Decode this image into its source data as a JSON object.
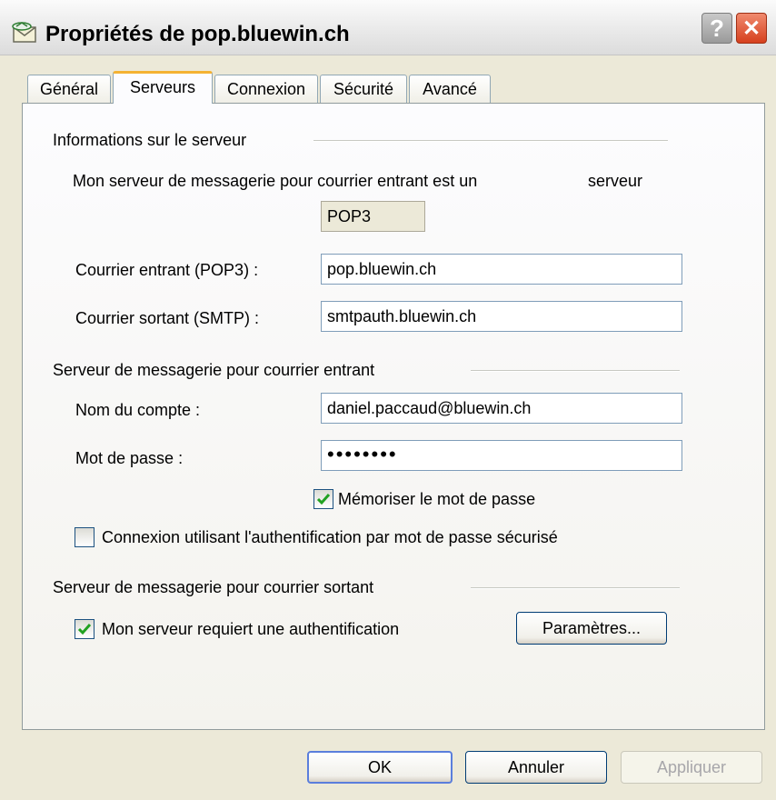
{
  "window": {
    "title": "Propriétés de pop.bluewin.ch",
    "help_symbol": "?",
    "close_symbol": "✕"
  },
  "tabs": [
    {
      "label": "Général",
      "active": false
    },
    {
      "label": "Serveurs",
      "active": true
    },
    {
      "label": "Connexion",
      "active": false
    },
    {
      "label": "Sécurité",
      "active": false
    },
    {
      "label": "Avancé",
      "active": false
    }
  ],
  "server_info": {
    "group_title": "Informations sur le serveur",
    "incoming_type_text": "Mon serveur de messagerie pour courrier entrant est un",
    "incoming_type_suffix": "serveur",
    "incoming_type_value": "POP3",
    "incoming_label": "Courrier entrant (POP3) :",
    "incoming_value": "pop.bluewin.ch",
    "outgoing_label": "Courrier sortant (SMTP) :",
    "outgoing_value": "smtpauth.bluewin.ch"
  },
  "incoming_server": {
    "group_title": "Serveur de messagerie pour courrier entrant",
    "account_label": "Nom du compte :",
    "account_value": "daniel.paccaud@bluewin.ch",
    "password_label": "Mot de passe :",
    "password_value": "••••••••",
    "remember_password_label": "Mémoriser le mot de passe",
    "remember_password_checked": true,
    "spa_label": "Connexion utilisant l'authentification par mot de passe sécurisé",
    "spa_checked": false
  },
  "outgoing_server": {
    "group_title": "Serveur de messagerie pour courrier sortant",
    "auth_label": "Mon serveur requiert une authentification",
    "auth_checked": true,
    "settings_button": "Paramètres..."
  },
  "buttons": {
    "ok": "OK",
    "cancel": "Annuler",
    "apply": "Appliquer"
  },
  "colors": {
    "window_bg": "#ece9d8",
    "active_tab_accent": "#f4b232",
    "checkmark": "#21a121",
    "close_button": "#d6401e"
  }
}
